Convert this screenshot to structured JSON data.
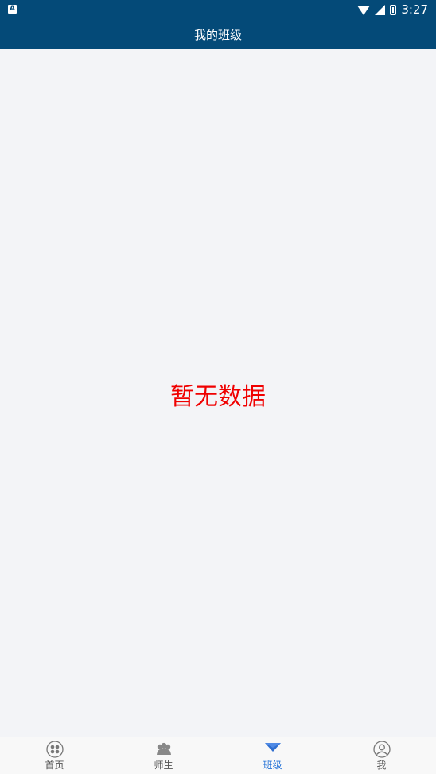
{
  "status_bar": {
    "notification_icon_letter": "A",
    "time": "3:27",
    "icons": [
      "wifi-icon",
      "cell-signal-icon",
      "battery-icon"
    ]
  },
  "header": {
    "title": "我的班级"
  },
  "main": {
    "empty_message": "暂无数据"
  },
  "tabbar": {
    "tabs": [
      {
        "label": "首页",
        "icon": "home-grid-icon",
        "active": false
      },
      {
        "label": "师生",
        "icon": "people-icon",
        "active": false
      },
      {
        "label": "班级",
        "icon": "class-triangle-icon",
        "active": true
      },
      {
        "label": "我",
        "icon": "user-icon",
        "active": false
      }
    ],
    "active_color": "#1f6fd6",
    "inactive_color": "#555555"
  },
  "colors": {
    "header_bg": "#044a78",
    "page_bg": "#f3f4f7",
    "empty_text": "#f00000"
  }
}
